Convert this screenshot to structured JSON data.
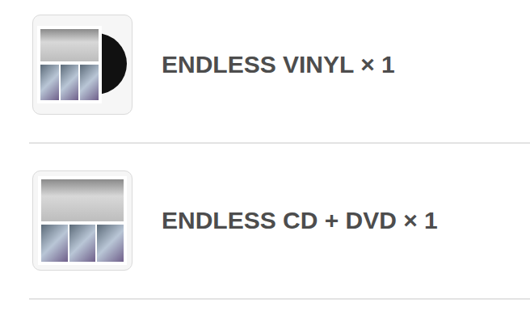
{
  "items": [
    {
      "label": "ENDLESS VINYL × 1",
      "kind": "vinyl"
    },
    {
      "label": "ENDLESS CD + DVD × 1",
      "kind": "cd-dvd"
    }
  ]
}
